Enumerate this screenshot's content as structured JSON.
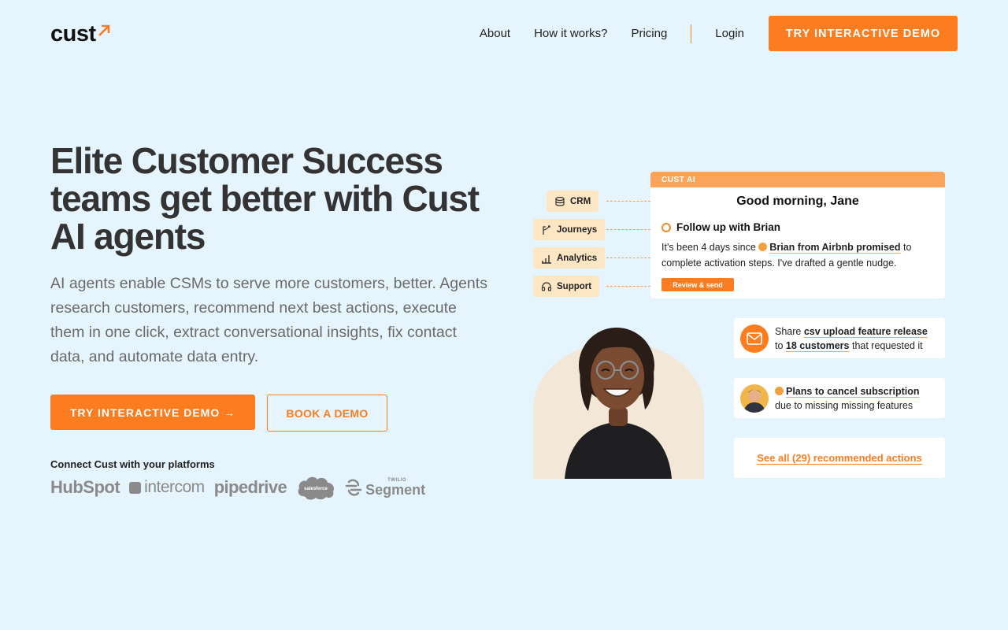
{
  "brand": {
    "logo_text": "cust",
    "accent": "#fb7d1f",
    "background": "#e6f4fd"
  },
  "nav": {
    "links": [
      "About",
      "How it works?",
      "Pricing"
    ],
    "login": "Login",
    "cta": "TRY INTERACTIVE DEMO"
  },
  "hero": {
    "title": "Elite Customer Success teams get better with Cust AI agents",
    "subtitle": "AI agents enable CSMs to serve more customers, better. Agents research customers, recommend next best actions, execute them in one click, extract conversational insights, fix contact data, and automate data entry.",
    "primary_cta": "TRY INTERACTIVE DEMO →",
    "secondary_cta": "BOOK A DEMO",
    "connect_label": "Connect Cust with your platforms",
    "partners": {
      "hubspot": "HubSpot",
      "intercom": "intercom",
      "pipedrive": "pipedrive",
      "salesforce": "salesforce",
      "segment_top": "TWILIO",
      "segment": "Segment"
    }
  },
  "illustration": {
    "tags": [
      {
        "label": "CRM",
        "icon": "database-icon"
      },
      {
        "label": "Journeys",
        "icon": "branch-icon"
      },
      {
        "label": "Analytics",
        "icon": "bar-chart-icon"
      },
      {
        "label": "Support",
        "icon": "headset-icon"
      }
    ],
    "card": {
      "header": "CUST AI",
      "greeting": "Good morning, Jane",
      "task": "Follow up with Brian",
      "text_prefix": "It's been 4 days since ",
      "text_highlight": "Brian from Airbnb promised",
      "text_suffix": " to complete activation steps. I've drafted a gentle nudge.",
      "button": "Review & send"
    },
    "actions": [
      {
        "icon": "mail-icon",
        "parts": [
          "Share ",
          "csv upload feature release",
          " to ",
          "18 customers",
          " that requested it"
        ]
      },
      {
        "icon": "avatar",
        "parts": [
          "Plans to cancel subscription",
          "due to missing missing features"
        ]
      }
    ],
    "see_all": "See all (29) recommended actions"
  }
}
